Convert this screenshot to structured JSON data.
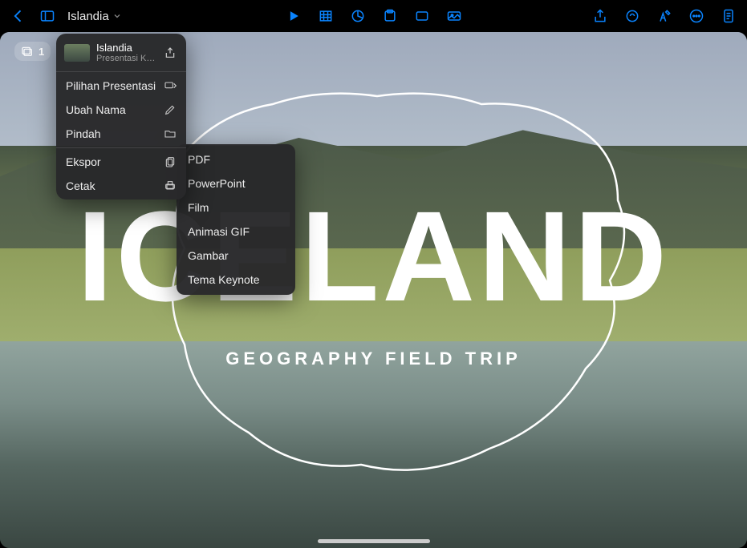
{
  "toolbar": {
    "doc_title": "Islandia"
  },
  "thumbs": {
    "count": "1"
  },
  "hero": {
    "title": "ICELAND",
    "subtitle": "GEOGRAPHY FIELD TRIP"
  },
  "popover": {
    "title": "Islandia",
    "subtitle": "Presentasi Keynote…",
    "rows": [
      {
        "label": "Pilihan Presentasi",
        "icon": "presentation"
      },
      {
        "label": "Ubah Nama",
        "icon": "pencil"
      },
      {
        "label": "Pindah",
        "icon": "folder"
      },
      {
        "label": "Ekspor",
        "icon": "export"
      },
      {
        "label": "Cetak",
        "icon": "print"
      }
    ]
  },
  "submenu": {
    "items": [
      {
        "label": "PDF"
      },
      {
        "label": "PowerPoint"
      },
      {
        "label": "Film"
      },
      {
        "label": "Animasi GIF"
      },
      {
        "label": "Gambar"
      },
      {
        "label": "Tema Keynote"
      }
    ]
  }
}
